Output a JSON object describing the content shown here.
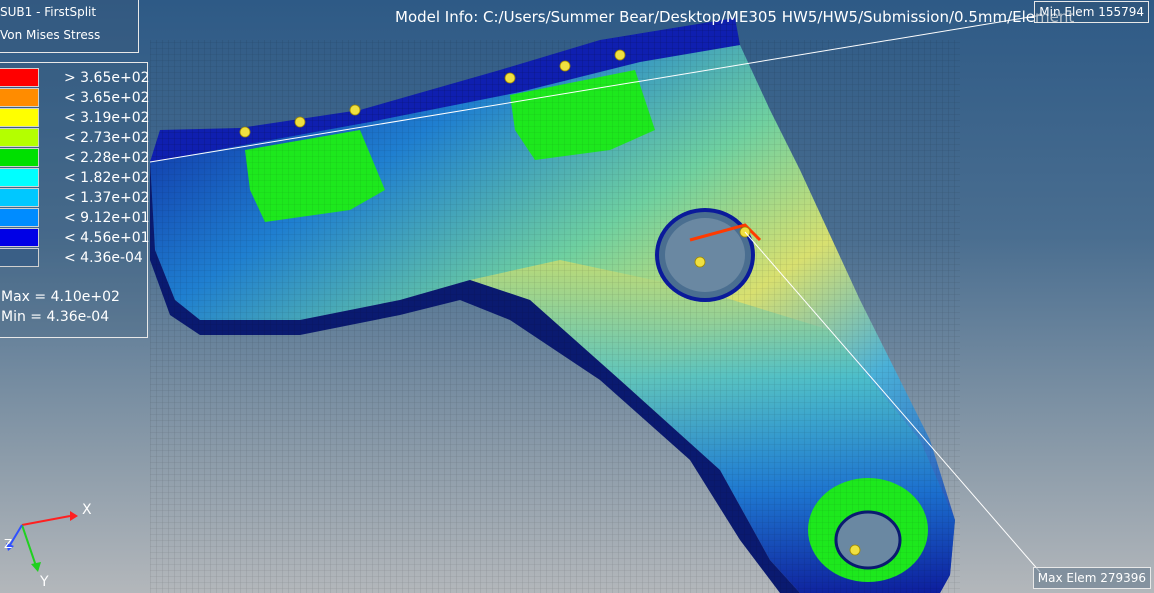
{
  "header": {
    "subcase": "SUB1 - FirstSplit",
    "result_type": "Von Mises Stress",
    "model_info": "Model Info: C:/Users/Summer Bear/Desktop/ME305 HW5/HW5/Submission/0.5mm/Element"
  },
  "legend": {
    "entries": [
      {
        "label": "> 3.65e+02",
        "color": "#ff0000"
      },
      {
        "label": "< 3.65e+02",
        "color": "#ff8c00"
      },
      {
        "label": "< 3.19e+02",
        "color": "#ffff00"
      },
      {
        "label": "< 2.73e+02",
        "color": "#b4ff00"
      },
      {
        "label": "< 2.28e+02",
        "color": "#00e000"
      },
      {
        "label": "< 1.82e+02",
        "color": "#00ffff"
      },
      {
        "label": "< 1.37e+02",
        "color": "#00c8ff"
      },
      {
        "label": "< 9.12e+01",
        "color": "#008cff"
      },
      {
        "label": "< 4.56e+01",
        "color": "#0000e6"
      },
      {
        "label": "< 4.36e-04",
        "color": "#3a5f86"
      }
    ],
    "max_text": "Max = 4.10e+02",
    "min_text": "Min = 4.36e-04"
  },
  "tags": {
    "min_elem": "Min Elem 155794",
    "max_elem": "Max Elem 279396"
  },
  "triad": {
    "x_label": "X",
    "y_label": "Y",
    "z_label": "Z",
    "x_color": "#ff2020",
    "y_color": "#20d020",
    "z_color": "#3050ff"
  }
}
